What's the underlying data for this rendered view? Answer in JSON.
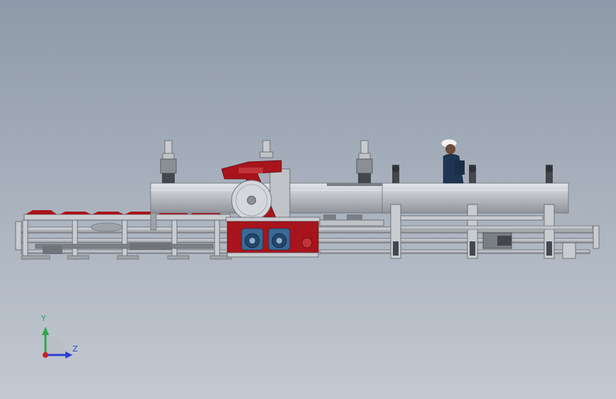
{
  "axes": {
    "y_label": "Y",
    "z_label": "Z"
  },
  "colors": {
    "background_top": "#8e9aa9",
    "background_bottom": "#c3c9d2",
    "frame_light": "#c9cdd2",
    "frame_dark": "#5d6167",
    "pipe": "#bfc3c8",
    "machine_red": "#a8141c",
    "motor_blue": "#3a6a96",
    "y_axis": "#2fa84a",
    "z_axis": "#2b3fd0",
    "origin": "#c8201e"
  },
  "scene": {
    "description_icon": "pipe-cutting-saw-machine"
  }
}
